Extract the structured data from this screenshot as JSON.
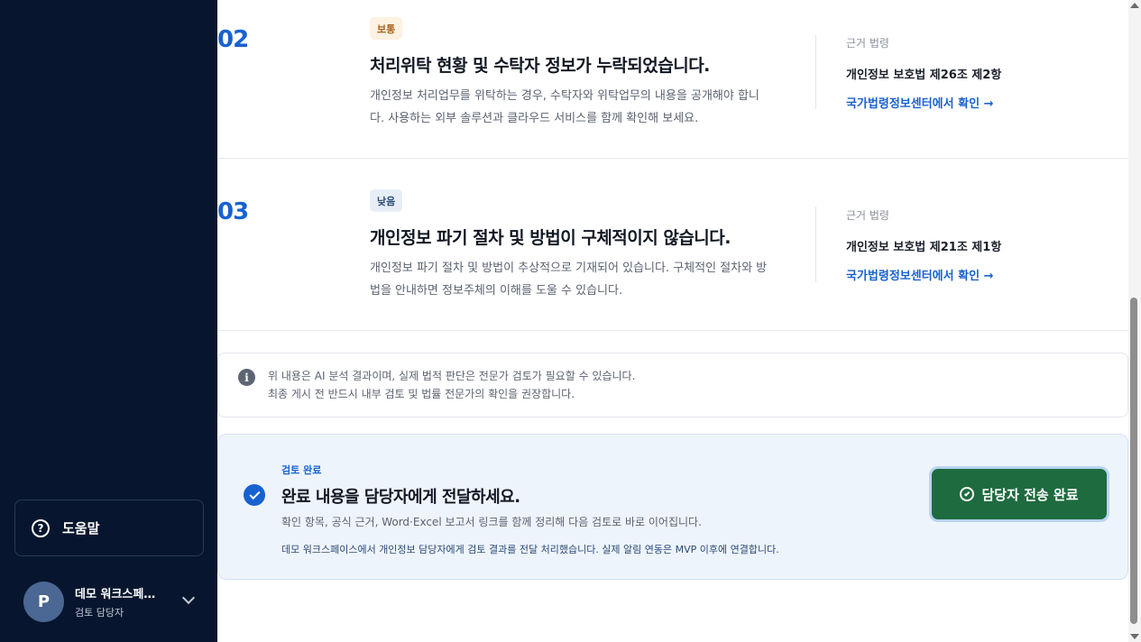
{
  "sidebar": {
    "help_label": "도움말",
    "user": {
      "initial": "P",
      "name": "데모 워크스페…",
      "role": "검토 담당자"
    }
  },
  "issues": [
    {
      "number": "02",
      "severity": "보통",
      "title": "처리위탁 현황 및 수탁자 정보가 누락되었습니다.",
      "desc_line1": "개인정보 처리업무를 위탁하는 경우, 수탁자와 위탁업무의 내용을 공개해야 합니",
      "desc_line2": "다. 사용하는 외부 솔루션과 클라우드 서비스를 함께 확인해 보세요.",
      "law_head": "근거 법령",
      "law_name": "개인정보 보호법 제26조 제2항",
      "law_link": "국가법령정보센터에서 확인 →"
    },
    {
      "number": "03",
      "severity": "낮음",
      "title": "개인정보 파기 절차 및 방법이 구체적이지 않습니다.",
      "desc_line1": "개인정보 파기 절차 및 방법이 추상적으로 기재되어 있습니다. 구체적인 절차와 방",
      "desc_line2": "법을 안내하면 정보주체의 이해를 도울 수 있습니다.",
      "law_head": "근거 법령",
      "law_name": "개인정보 보호법 제21조 제1항",
      "law_link": "국가법령정보센터에서 확인 →"
    }
  ],
  "notice": {
    "icon": "info-icon",
    "line1": "위 내용은 AI 분석 결과이며, 실제 법적 판단은 전문가 검토가 필요할 수 있습니다.",
    "line2": "최종 게시 전 반드시 내부 검토 및 법률 전문가의 확인을 권장합니다."
  },
  "completion": {
    "label": "검토 완료",
    "title": "완료 내용을 담당자에게 전달하세요.",
    "desc": "확인 항목, 공식 근거, Word·Excel 보고서 링크를 함께 정리해 다음 검토로 바로 이어집니다.",
    "note": "데모 워크스페이스에서 개인정보 담당자에게 검토 결과를 전달 처리했습니다. 실제 알림 연동은 MVP 이후에 연결합니다.",
    "button_label": "담당자 전송 완료"
  },
  "colors": {
    "sidebar_bg": "#07162e",
    "accent": "#1862d0",
    "button_green": "#1e6b3f"
  }
}
